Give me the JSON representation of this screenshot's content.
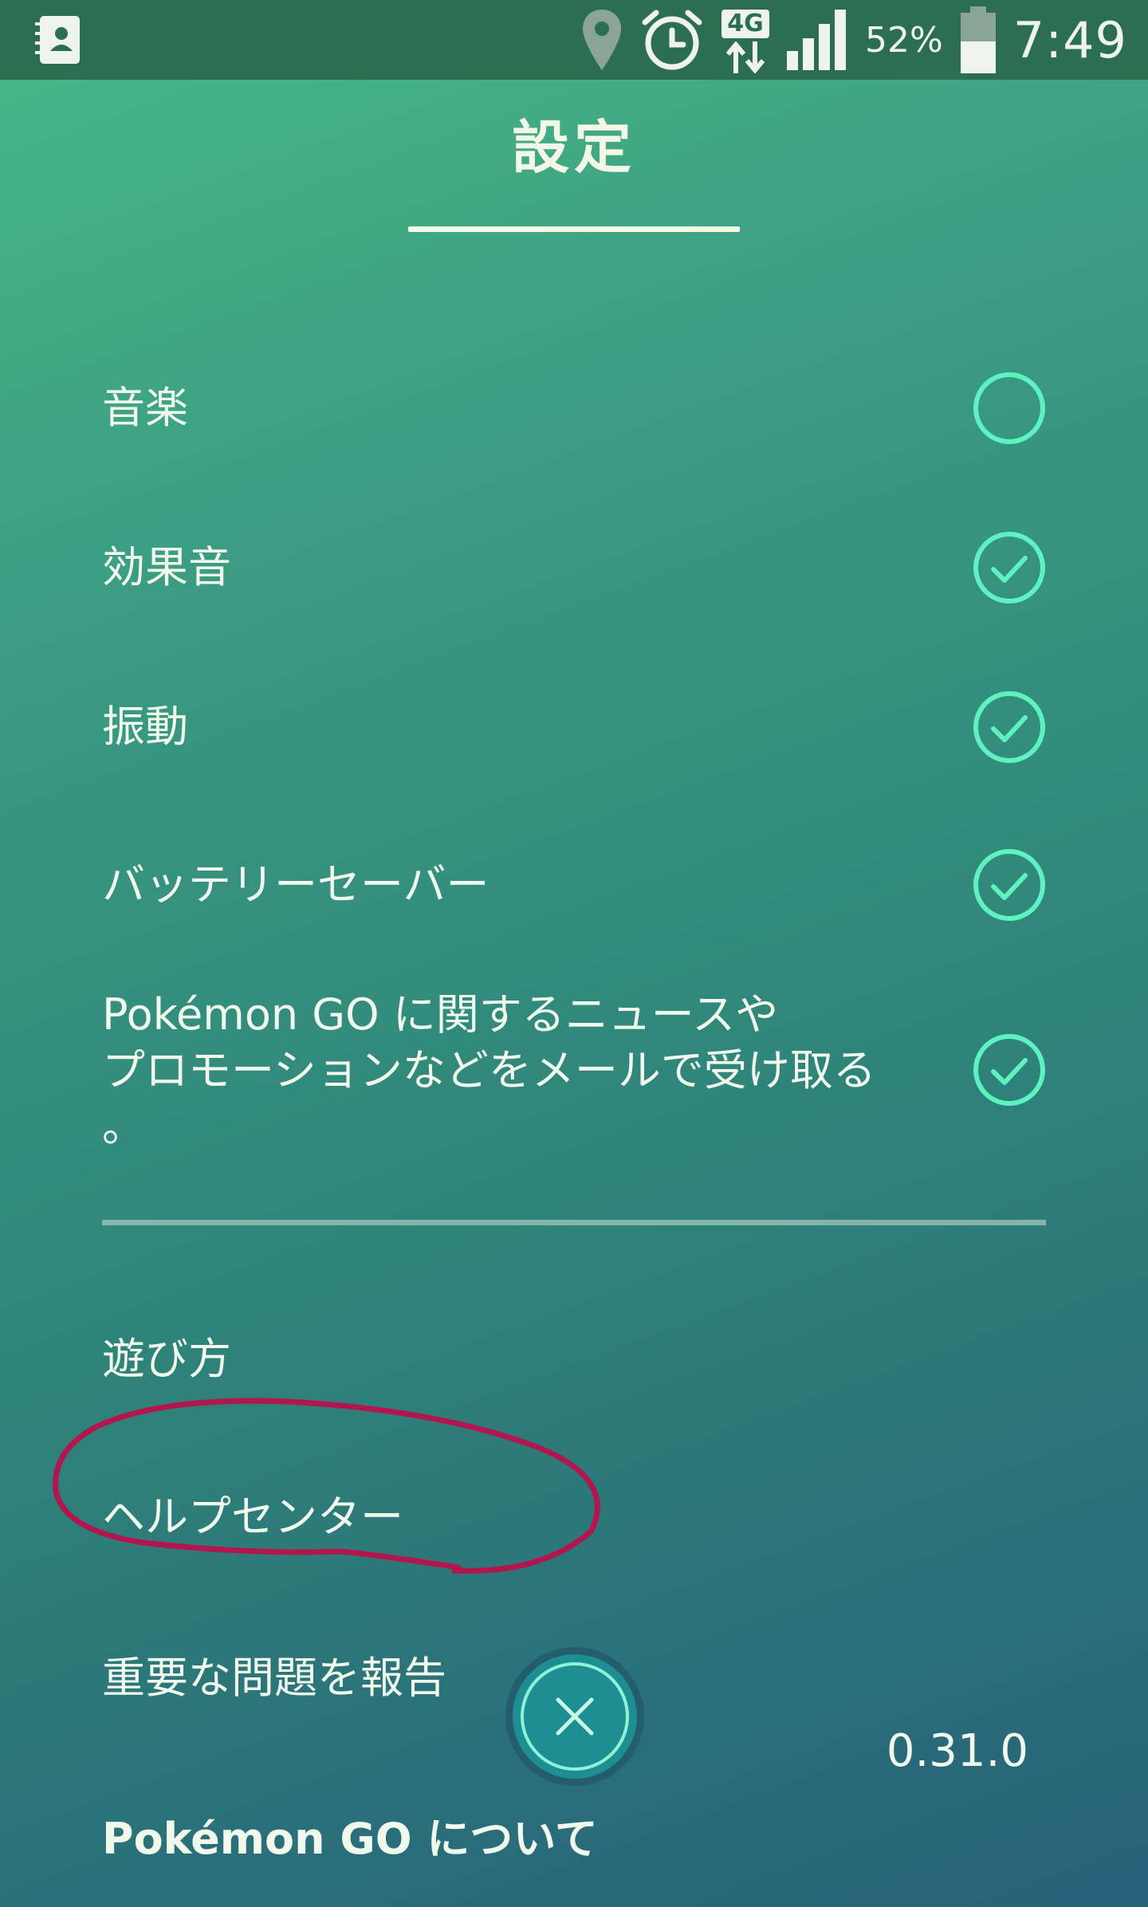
{
  "status_bar": {
    "icons": [
      "contacts-icon",
      "location-icon",
      "alarm-icon",
      "network-4g-icon",
      "signal-icon",
      "battery-icon"
    ],
    "network_label": "4G",
    "battery_percent": "52%",
    "time": "7:49"
  },
  "header": {
    "title": "設定"
  },
  "settings": [
    {
      "label": "音楽",
      "checked": false
    },
    {
      "label": "効果音",
      "checked": true
    },
    {
      "label": "振動",
      "checked": true
    },
    {
      "label": "バッテリーセーバー",
      "checked": true
    },
    {
      "label": "Pokémon GO に関するニュースや\nプロモーションなどをメールで受け取る\n。",
      "checked": true
    }
  ],
  "links": {
    "how_to_play": "遊び方",
    "help_center": "ヘルプセンター",
    "report_issue": "重要な問題を報告",
    "about": "Pokémon GO について"
  },
  "version": "0.31.0",
  "colors": {
    "toggle_accent": "#5ef2c0",
    "annotation": "#b3164e",
    "close_button_bg": "#1e8e92"
  },
  "close_button": {
    "icon": "close-icon"
  }
}
